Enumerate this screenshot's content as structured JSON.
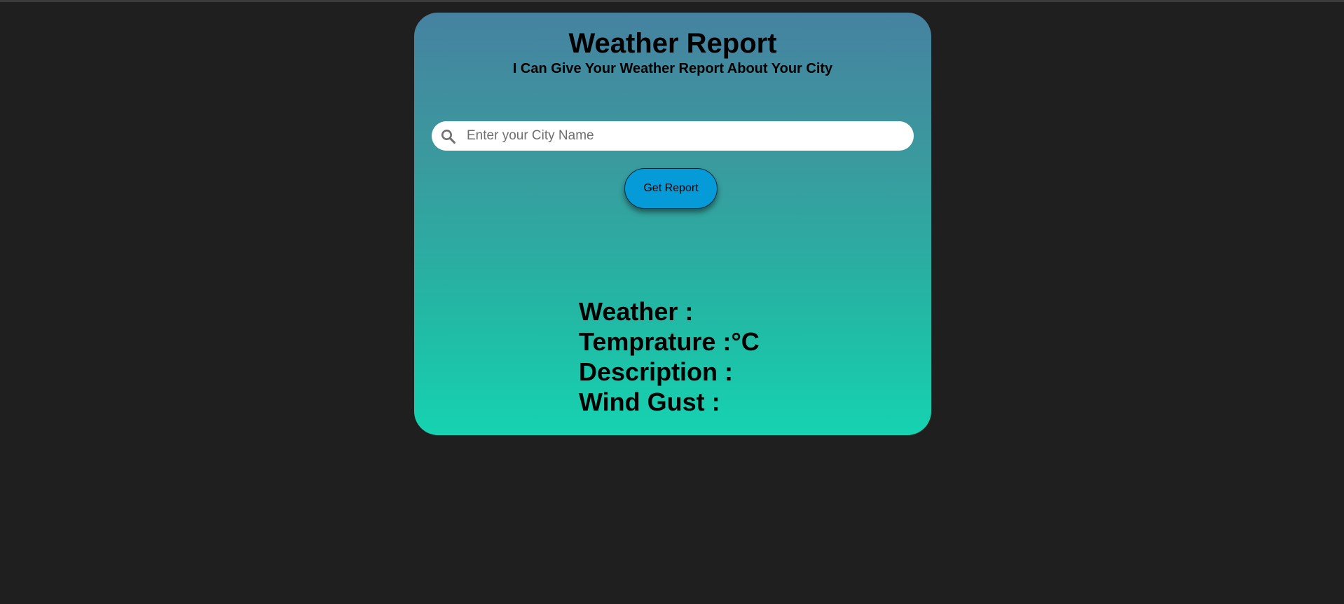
{
  "header": {
    "title": "Weather Report",
    "subtitle": "I Can Give Your Weather Report About Your City"
  },
  "search": {
    "placeholder": "Enter your City Name",
    "value": "",
    "icon": "search-icon"
  },
  "actions": {
    "get_report_label": "Get Report"
  },
  "results": {
    "weather": "Weather :",
    "temperature": "Temprature :°C",
    "description": "Description :",
    "wind_gust": "Wind Gust :"
  },
  "colors": {
    "page_background": "#1f1f1f",
    "card_gradient_top": "#4682a0",
    "card_gradient_bottom": "#15d3b0",
    "button_background": "#049bd8"
  }
}
